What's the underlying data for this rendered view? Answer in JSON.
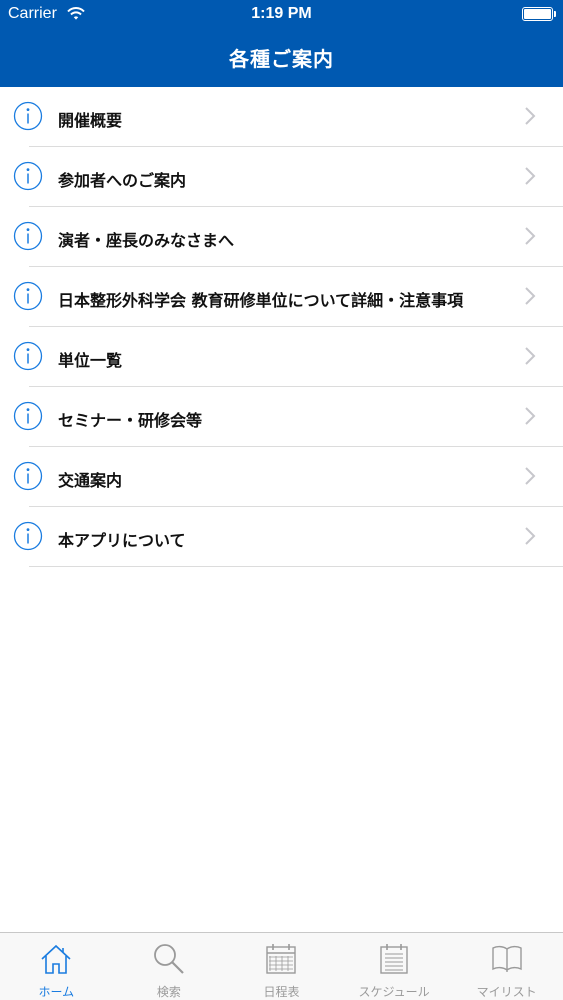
{
  "status_bar": {
    "carrier": "Carrier",
    "time": "1:19 PM"
  },
  "header": {
    "title": "各種ご案内"
  },
  "list": {
    "items": [
      {
        "label": "開催概要",
        "icon": "info-icon"
      },
      {
        "label": "参加者へのご案内",
        "icon": "info-icon"
      },
      {
        "label": "演者・座長のみなさまへ",
        "icon": "info-icon"
      },
      {
        "label": "日本整形外科学会 教育研修単位について詳細・注意事項",
        "icon": "info-icon"
      },
      {
        "label": "単位一覧",
        "icon": "info-icon"
      },
      {
        "label": "セミナー・研修会等",
        "icon": "info-icon"
      },
      {
        "label": "交通案内",
        "icon": "info-icon"
      },
      {
        "label": "本アプリについて",
        "icon": "info-icon"
      }
    ]
  },
  "tabbar": {
    "tabs": [
      {
        "label": "ホーム",
        "icon": "home-icon",
        "active": true
      },
      {
        "label": "検索",
        "icon": "search-icon",
        "active": false
      },
      {
        "label": "日程表",
        "icon": "calendar-icon",
        "active": false
      },
      {
        "label": "スケジュール",
        "icon": "schedule-icon",
        "active": false
      },
      {
        "label": "マイリスト",
        "icon": "book-icon",
        "active": false
      }
    ]
  },
  "colors": {
    "header_bg": "#0059b1",
    "accent": "#1a7ce0",
    "separator": "#dcdcdc",
    "chevron": "#c7c7cc",
    "tab_inactive": "#9a9a9a"
  }
}
